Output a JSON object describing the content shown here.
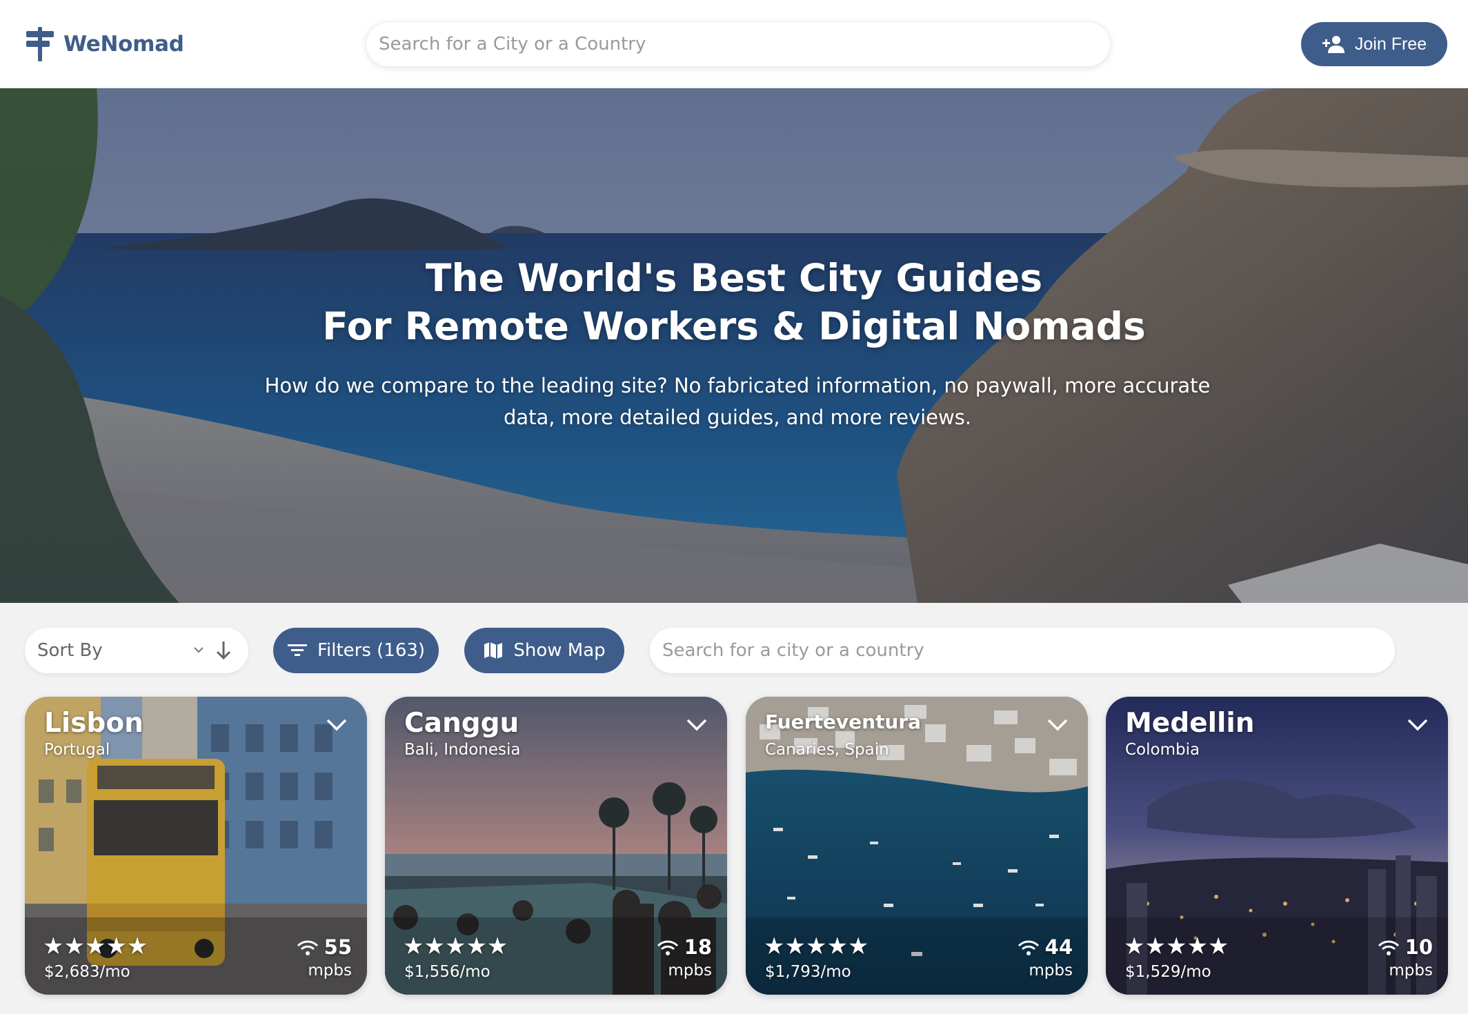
{
  "header": {
    "brand": "WeNomad",
    "search_placeholder": "Search for a City or a Country",
    "join_label": "Join Free"
  },
  "hero": {
    "title_line1": "The World's Best City Guides",
    "title_line2": "For Remote Workers & Digital Nomads",
    "subtitle": "How do we compare to the leading site? No fabricated information, no paywall, more accurate data, more detailed guides, and more reviews."
  },
  "toolbar": {
    "sort_label": "Sort By",
    "filters_label": "Filters (163)",
    "map_label": "Show Map",
    "search_placeholder": "Search for a city or a country"
  },
  "cards": [
    {
      "city": "Lisbon",
      "country": "Portugal",
      "stars": "★★★★★",
      "price": "$2,683/mo",
      "speed": "55",
      "unit": "mpbs"
    },
    {
      "city": "Canggu",
      "country": "Bali, Indonesia",
      "stars": "★★★★★",
      "price": "$1,556/mo",
      "speed": "18",
      "unit": "mpbs"
    },
    {
      "city": "Fuerteventura",
      "country": "Canaries, Spain",
      "stars": "★★★★★",
      "price": "$1,793/mo",
      "speed": "44",
      "unit": "mpbs"
    },
    {
      "city": "Medellin",
      "country": "Colombia",
      "stars": "★★★★★",
      "price": "$1,529/mo",
      "speed": "10",
      "unit": "mpbs"
    }
  ],
  "colors": {
    "brand": "#3f5d8a",
    "background": "#f2f2f3"
  },
  "icons": [
    "signpost-icon",
    "add-user-icon",
    "chevron-down-icon",
    "arrow-down-icon",
    "filter-icon",
    "map-icon",
    "wifi-icon"
  ]
}
